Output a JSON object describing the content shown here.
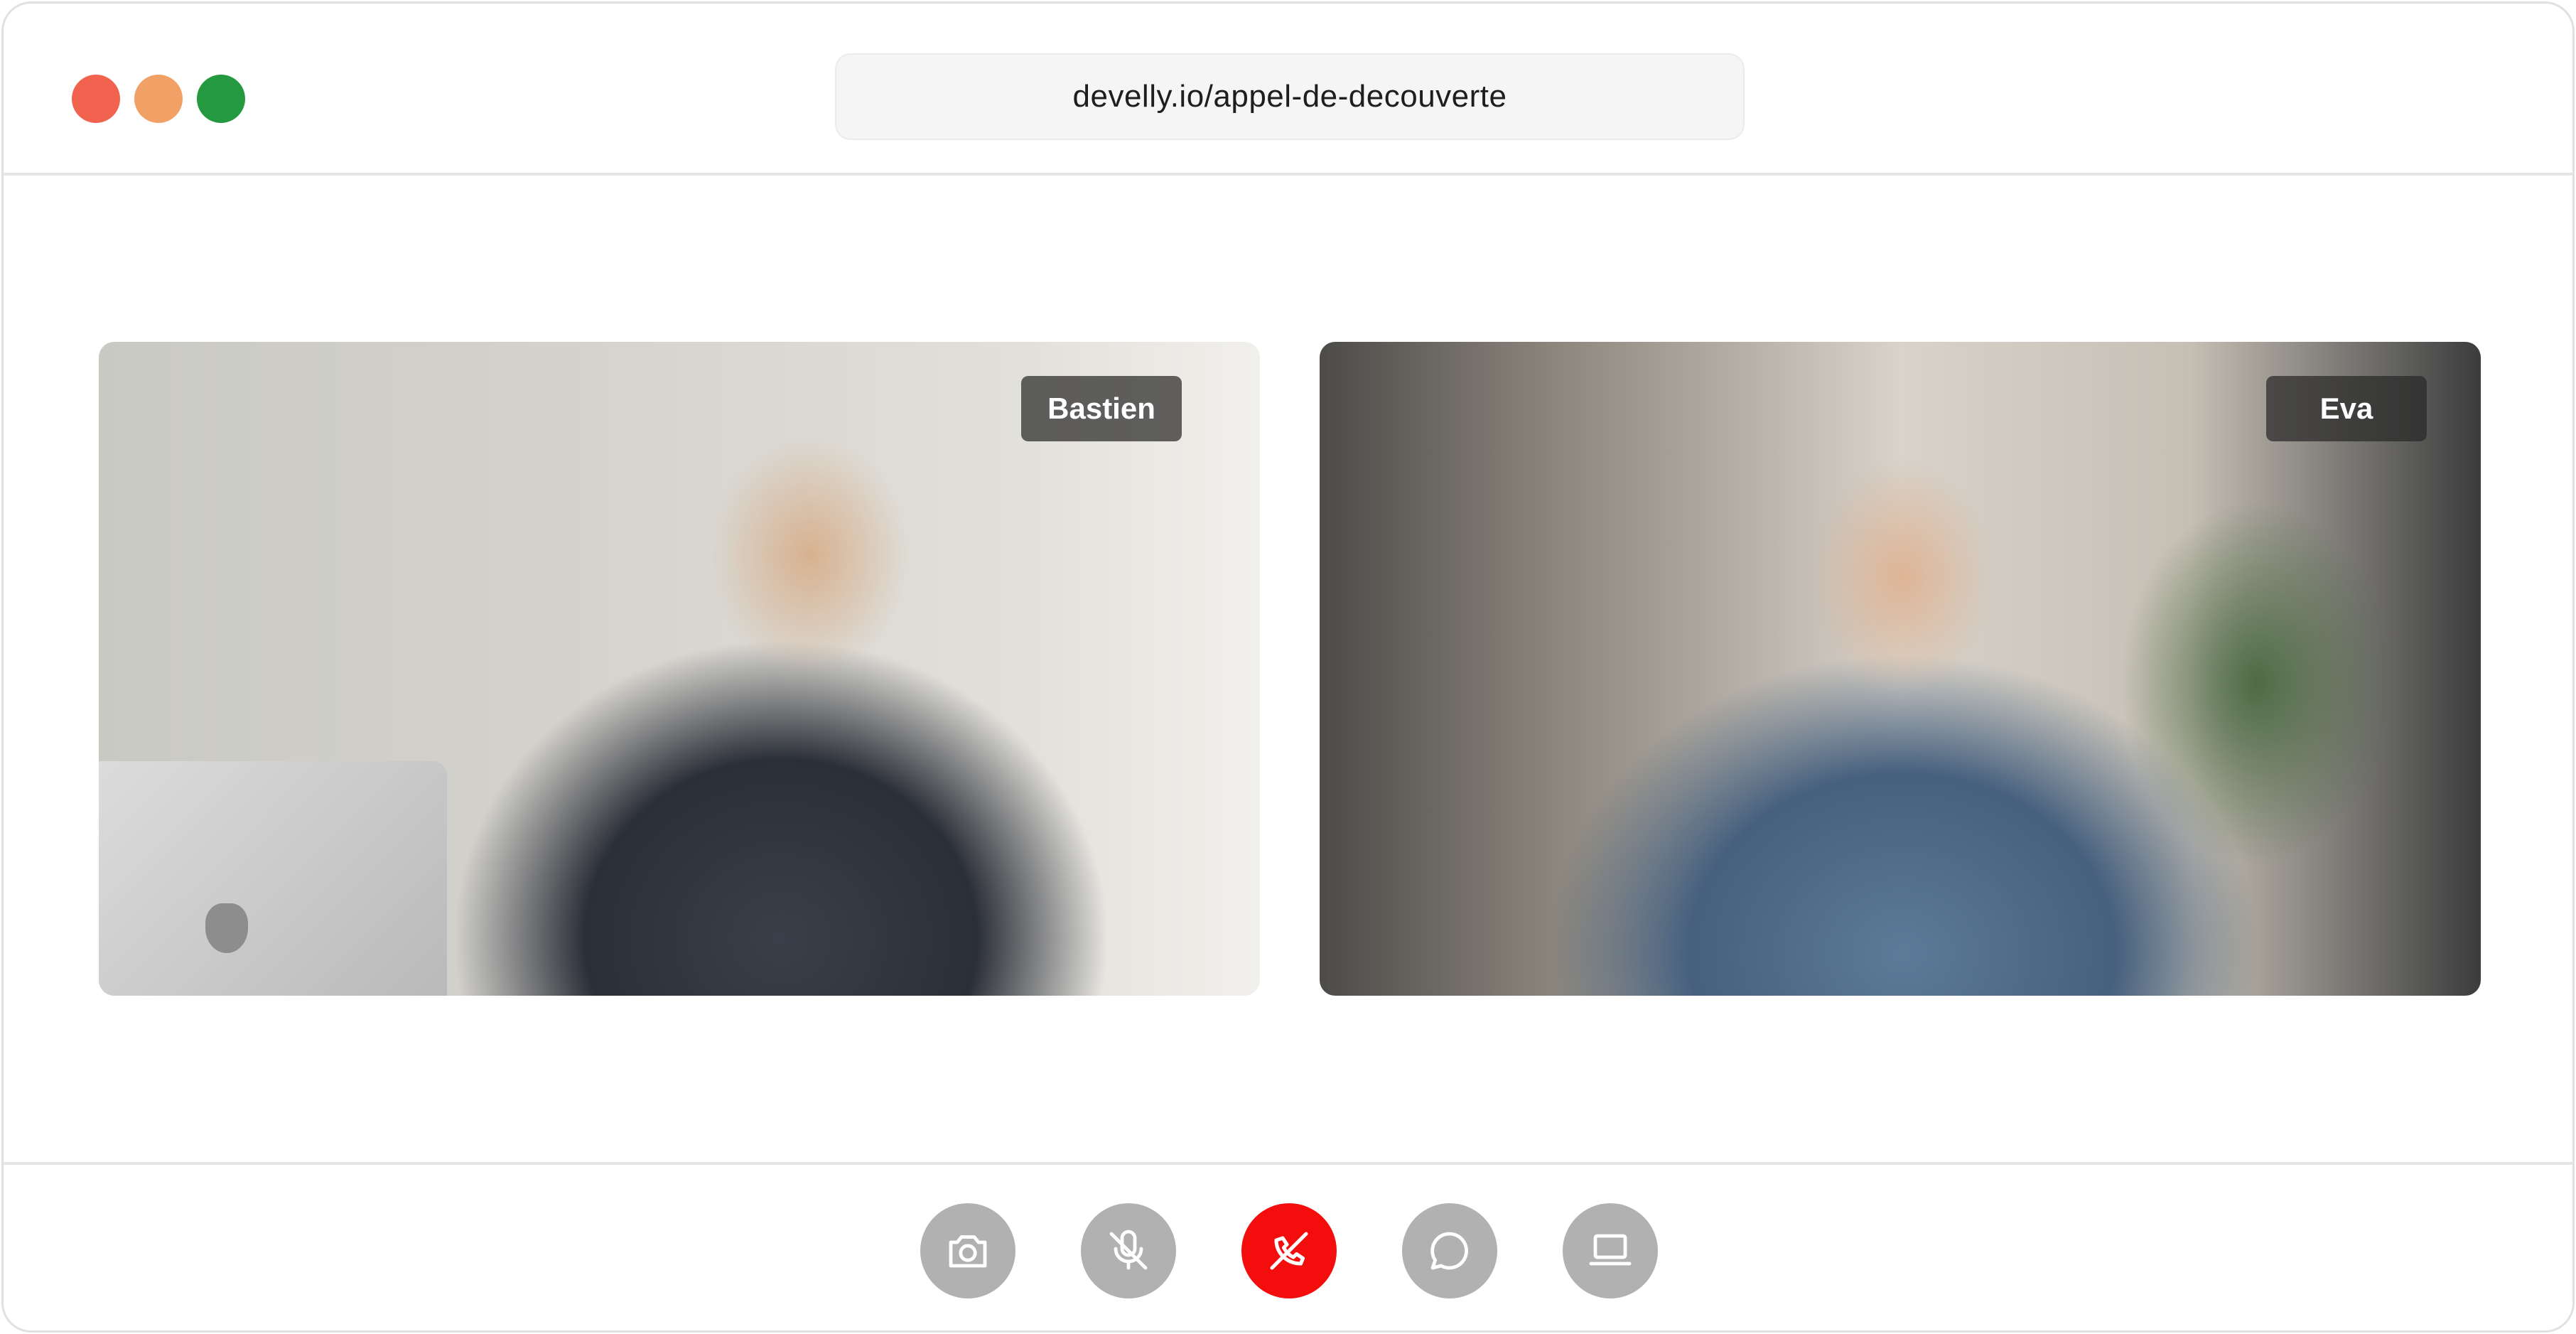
{
  "window": {
    "controls": [
      "close",
      "minimize",
      "maximize"
    ],
    "url": "develly.io/appel-de-decouverte"
  },
  "participants": [
    {
      "name": "Bastien"
    },
    {
      "name": "Eva"
    }
  ],
  "controls": [
    {
      "name": "camera",
      "icon": "camera-icon"
    },
    {
      "name": "mute-mic",
      "icon": "mic-off-icon"
    },
    {
      "name": "hang-up",
      "icon": "phone-off-icon",
      "color": "#f30d0d"
    },
    {
      "name": "chat",
      "icon": "chat-icon"
    },
    {
      "name": "screen-share",
      "icon": "laptop-icon"
    }
  ],
  "colors": {
    "close": "#f2634f",
    "minimize": "#f2a166",
    "maximize": "#24993f",
    "control_bg": "#b1b1b1",
    "hangup_bg": "#f30d0d"
  }
}
